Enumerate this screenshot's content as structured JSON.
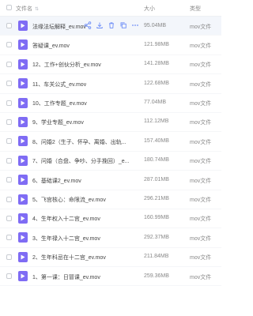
{
  "header": {
    "name": "文件名",
    "size": "大小",
    "type": "类型"
  },
  "files": [
    {
      "name": "法缘法坛解释_ev.mov",
      "size": "95.04MB",
      "type": "mov文件"
    },
    {
      "name": "答疑课_ev.mov",
      "size": "121.98MB",
      "type": "mov文件"
    },
    {
      "name": "12、工作+创伙分析_ev.mov",
      "size": "141.28MB",
      "type": "mov文件"
    },
    {
      "name": "11、车关公式_ev.mov",
      "size": "122.68MB",
      "type": "mov文件"
    },
    {
      "name": "10、工作专题_ev.mov",
      "size": "77.04MB",
      "type": "mov文件"
    },
    {
      "name": "9、学业专题_ev.mov",
      "size": "112.12MB",
      "type": "mov文件"
    },
    {
      "name": "8、问婚2（生子、怀孕、离婚、出轨...",
      "size": "157.40MB",
      "type": "mov文件"
    },
    {
      "name": "7、问婚（合盘、争吵、分手挽回）_e...",
      "size": "180.74MB",
      "type": "mov文件"
    },
    {
      "name": "6、基础课2_ev.mov",
      "size": "287.01MB",
      "type": "mov文件"
    },
    {
      "name": "5、飞宫核心：命限流_ev.mov",
      "size": "296.21MB",
      "type": "mov文件"
    },
    {
      "name": "4、生年权入十二宫_ev.mov",
      "size": "160.99MB",
      "type": "mov文件"
    },
    {
      "name": "3、生年禄入十二宫_ev.mov",
      "size": "292.37MB",
      "type": "mov文件"
    },
    {
      "name": "2、生年科忌在十二宫_ev.mov",
      "size": "211.84MB",
      "type": "mov文件"
    },
    {
      "name": "1、第一课：日冒课_ev.mov",
      "size": "259.36MB",
      "type": "mov文件"
    }
  ],
  "row_actions": [
    "share-icon",
    "download-icon",
    "delete-icon",
    "copy-icon",
    "more-icon"
  ],
  "colors": {
    "file_icon": "#7f6cf4",
    "action_icon": "#6e8ef7",
    "highlight": "#f3f6fb"
  }
}
